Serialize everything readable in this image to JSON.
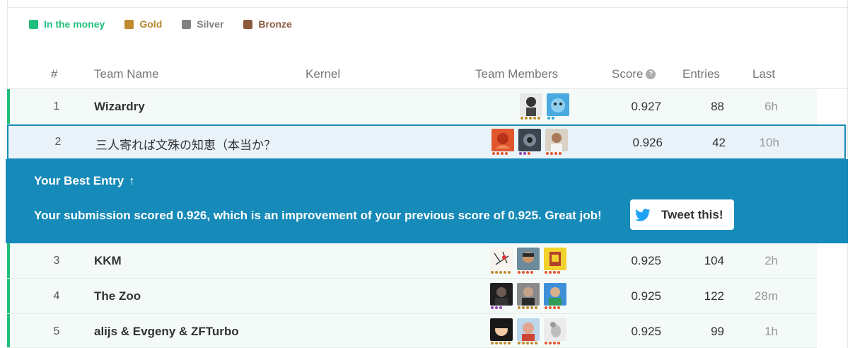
{
  "legend": [
    {
      "label": "In the money",
      "color": "#20be7c"
    },
    {
      "label": "Gold",
      "color": "#c08a2e"
    },
    {
      "label": "Silver",
      "color": "#808080"
    },
    {
      "label": "Bronze",
      "color": "#8b5a3c"
    }
  ],
  "header": {
    "rank": "#",
    "team_name": "Team Name",
    "kernel": "Kernel",
    "team_members": "Team Members",
    "score": "Score",
    "score_help_icon": "?",
    "entries": "Entries",
    "last": "Last"
  },
  "rows": [
    {
      "rank": "1",
      "team": "Wizardry",
      "score": "0.927",
      "entries": "88",
      "last": "6h"
    },
    {
      "rank": "2",
      "team": "三人寄れば文殊の知恵（本当か？",
      "score": "0.926",
      "entries": "42",
      "last": "10h"
    },
    {
      "rank": "3",
      "team": "KKM",
      "score": "0.925",
      "entries": "104",
      "last": "2h"
    },
    {
      "rank": "4",
      "team": "The Zoo",
      "score": "0.925",
      "entries": "122",
      "last": "28m"
    },
    {
      "rank": "5",
      "team": "alijs & Evgeny & ZFTurbo",
      "score": "0.925",
      "entries": "99",
      "last": "1h"
    }
  ],
  "banner": {
    "title": "Your Best Entry",
    "arrow_icon": "↑",
    "message": "Your submission scored 0.926, which is an improvement of your previous score of 0.925. Great job!",
    "tweet_label": "Tweet this!"
  }
}
